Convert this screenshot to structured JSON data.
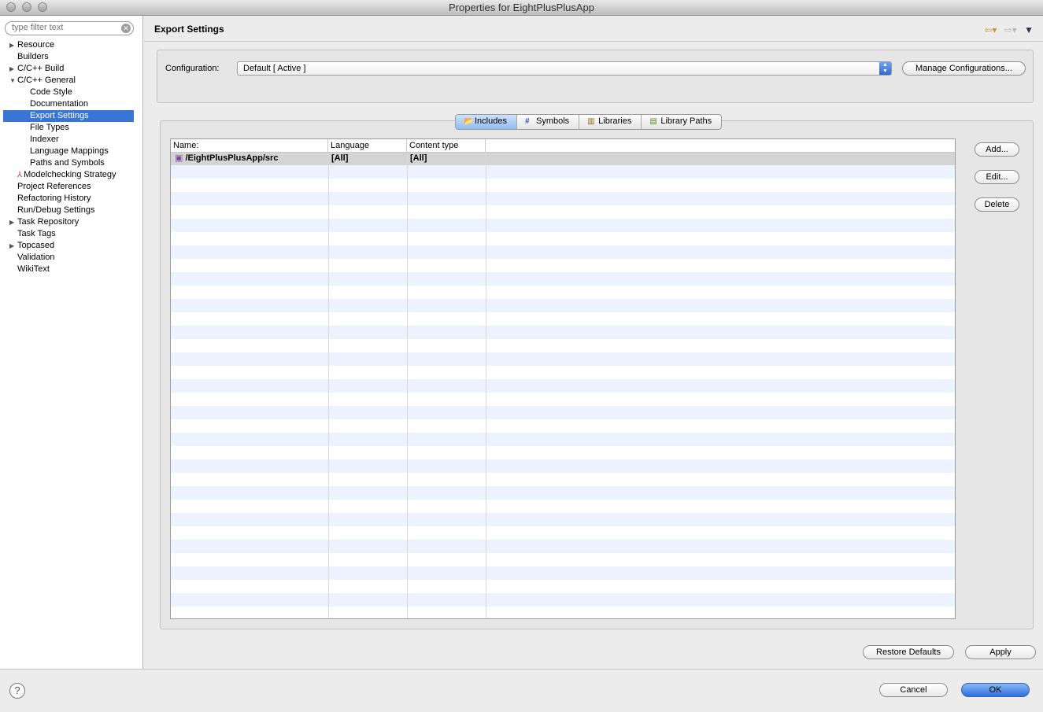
{
  "window": {
    "title": "Properties for EightPlusPlusApp"
  },
  "filter": {
    "placeholder": "type filter text"
  },
  "tree": [
    {
      "label": "Resource",
      "arrow": "▶"
    },
    {
      "label": "Builders",
      "arrow": ""
    },
    {
      "label": "C/C++ Build",
      "arrow": "▶"
    },
    {
      "label": "C/C++ General",
      "arrow": "▼"
    },
    {
      "label": "Code Style",
      "arrow": ""
    },
    {
      "label": "Documentation",
      "arrow": ""
    },
    {
      "label": "Export Settings",
      "arrow": ""
    },
    {
      "label": "File Types",
      "arrow": ""
    },
    {
      "label": "Indexer",
      "arrow": ""
    },
    {
      "label": "Language Mappings",
      "arrow": ""
    },
    {
      "label": "Paths and Symbols",
      "arrow": ""
    },
    {
      "label": "Modelchecking Strategy",
      "arrow": ""
    },
    {
      "label": "Project References",
      "arrow": ""
    },
    {
      "label": "Refactoring History",
      "arrow": ""
    },
    {
      "label": "Run/Debug Settings",
      "arrow": ""
    },
    {
      "label": "Task Repository",
      "arrow": "▶"
    },
    {
      "label": "Task Tags",
      "arrow": ""
    },
    {
      "label": "Topcased",
      "arrow": "▶"
    },
    {
      "label": "Validation",
      "arrow": ""
    },
    {
      "label": "WikiText",
      "arrow": ""
    }
  ],
  "page": {
    "title": "Export Settings"
  },
  "config": {
    "label": "Configuration:",
    "value": "Default  [ Active ]",
    "manage_label": "Manage Configurations..."
  },
  "tabs": [
    {
      "label": "Includes",
      "icon": "includes-icon"
    },
    {
      "label": "Symbols",
      "icon": "hash-icon"
    },
    {
      "label": "Libraries",
      "icon": "libraries-icon"
    },
    {
      "label": "Library Paths",
      "icon": "library-paths-icon"
    }
  ],
  "table": {
    "columns": [
      "Name:",
      "Language",
      "Content type"
    ],
    "rows": [
      {
        "name": "/EightPlusPlusApp/src",
        "language": "[All]",
        "content_type": "[All]"
      }
    ]
  },
  "side_buttons": {
    "add": "Add...",
    "edit": "Edit...",
    "delete": "Delete"
  },
  "footer": {
    "restore_defaults": "Restore Defaults",
    "apply": "Apply",
    "cancel": "Cancel",
    "ok": "OK",
    "help": "?"
  }
}
